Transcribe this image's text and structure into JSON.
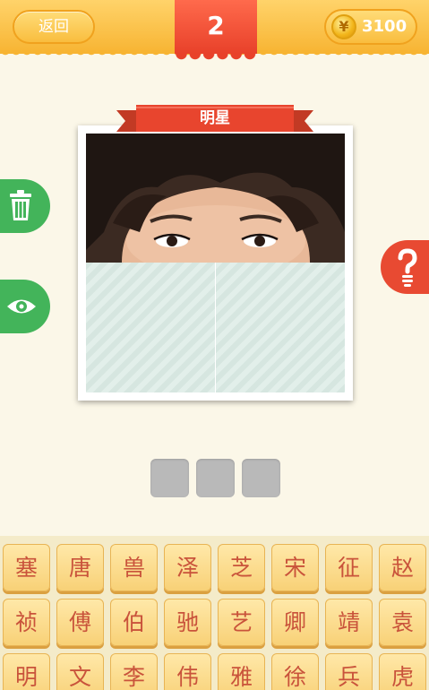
{
  "header": {
    "back_label": "返回",
    "level": "2",
    "coins": "3100",
    "coin_symbol": "¥"
  },
  "puzzle": {
    "category": "明星",
    "answer_slot_count": 3
  },
  "side_buttons": {
    "left": [
      "trash-icon",
      "eye-icon"
    ],
    "right": [
      "question-icon"
    ]
  },
  "keyboard": {
    "rows": [
      [
        "塞",
        "唐",
        "兽",
        "泽",
        "芝",
        "宋",
        "征",
        "赵"
      ],
      [
        "祯",
        "傅",
        "伯",
        "驰",
        "艺",
        "卿",
        "靖",
        "袁"
      ],
      [
        "明",
        "文",
        "李",
        "伟",
        "雅",
        "徐",
        "兵",
        "虎"
      ]
    ]
  },
  "colors": {
    "header": "#f7b432",
    "accent_red": "#e8412a",
    "green": "#43b45a",
    "key_text": "#c9533b"
  }
}
